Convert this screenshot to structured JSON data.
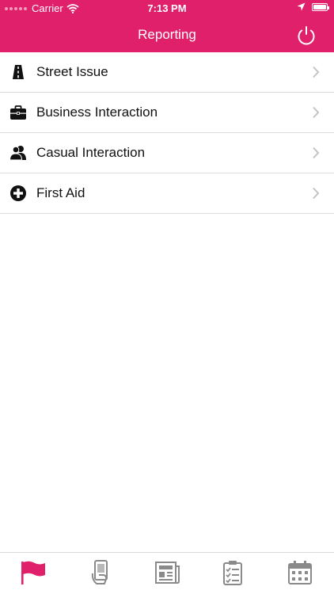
{
  "status": {
    "carrier": "Carrier",
    "time": "7:13 PM"
  },
  "header": {
    "title": "Reporting",
    "power_icon": "power-icon"
  },
  "menu": {
    "items": [
      {
        "label": "Street Issue",
        "icon": "road-icon"
      },
      {
        "label": "Business Interaction",
        "icon": "briefcase-icon"
      },
      {
        "label": "Casual Interaction",
        "icon": "people-icon"
      },
      {
        "label": "First Aid",
        "icon": "plus-circle-icon"
      }
    ]
  },
  "tabbar": {
    "tabs": [
      {
        "icon": "flag-icon",
        "selected": true
      },
      {
        "icon": "phone-hand-icon",
        "selected": false
      },
      {
        "icon": "newspaper-icon",
        "selected": false
      },
      {
        "icon": "checklist-icon",
        "selected": false
      },
      {
        "icon": "calendar-icon",
        "selected": false
      }
    ]
  },
  "colors": {
    "accent": "#E0206A",
    "tab_inactive": "#8a8a8a"
  }
}
